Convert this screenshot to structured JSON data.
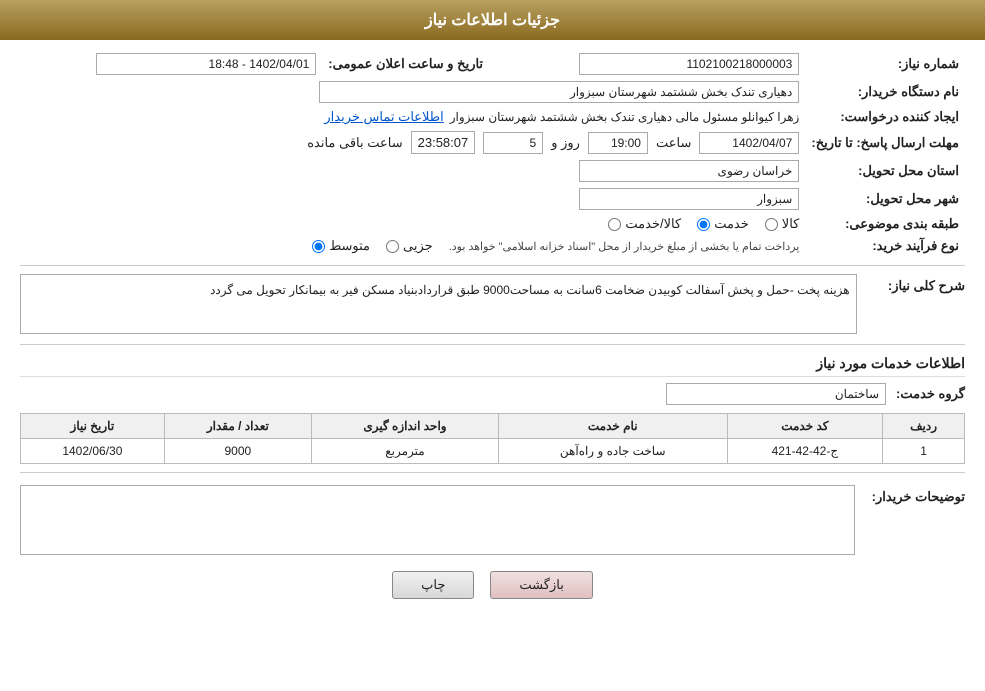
{
  "header": {
    "title": "جزئیات اطلاعات نیاز"
  },
  "fields": {
    "need_number_label": "شماره نیاز:",
    "need_number_value": "1102100218000003",
    "announcement_date_label": "تاریخ و ساعت اعلان عمومی:",
    "announcement_date_value": "1402/04/01 - 18:48",
    "requester_org_label": "نام دستگاه خریدار:",
    "requester_org_value": "دهیاری تندک بخش ششتمد شهرستان سبزوار",
    "creator_label": "ایجاد کننده درخواست:",
    "creator_value": "زهرا کیوانلو مسئول مالی دهیاری تندک بخش ششتمد شهرستان سبزوار",
    "contact_link": "اطلاعات تماس خریدار",
    "response_deadline_label": "مهلت ارسال پاسخ: تا تاریخ:",
    "response_date_value": "1402/04/07",
    "response_time_label": "ساعت",
    "response_time_value": "19:00",
    "response_days_label": "روز و",
    "response_days_value": "5",
    "response_remaining_label": "ساعت باقی مانده",
    "response_remaining_value": "23:58:07",
    "province_label": "استان محل تحویل:",
    "province_value": "خراسان رضوی",
    "city_label": "شهر محل تحویل:",
    "city_value": "سبزوار",
    "category_label": "طبقه بندی موضوعی:",
    "category_options": [
      "کالا",
      "خدمت",
      "کالا/خدمت"
    ],
    "category_selected": "خدمت",
    "procurement_label": "نوع فرآیند خرید:",
    "procurement_options": [
      "جزیی",
      "متوسط"
    ],
    "procurement_selected": "متوسط",
    "procurement_note": "پرداخت تمام یا بخشی از مبلغ خریدار از محل \"اسناد خزانه اسلامی\" خواهد بود.",
    "general_description_label": "شرح کلی نیاز:",
    "general_description_value": "هزینه پخت -حمل و پخش آسفالت  کوبیدن  ضخامت 6سانت به مساحت9000 طبق قراردادبنیاد مسکن فیر به بیمانکار تحویل می گردد",
    "services_section_label": "اطلاعات خدمات مورد نیاز",
    "service_group_label": "گروه خدمت:",
    "service_group_value": "ساختمان",
    "table_headers": {
      "row_num": "ردیف",
      "service_code": "کد خدمت",
      "service_name": "نام خدمت",
      "unit": "واحد اندازه گیری",
      "quantity": "تعداد / مقدار",
      "deadline": "تاریخ نیاز"
    },
    "table_rows": [
      {
        "row_num": "1",
        "service_code": "ج-42-42-421",
        "service_name": "ساخت جاده و راه‌آهن",
        "unit": "مترمربع",
        "quantity": "9000",
        "deadline": "1402/06/30"
      }
    ],
    "buyer_notes_label": "توضیحات خریدار:",
    "buyer_notes_value": ""
  },
  "buttons": {
    "print_label": "چاپ",
    "back_label": "بازگشت"
  }
}
